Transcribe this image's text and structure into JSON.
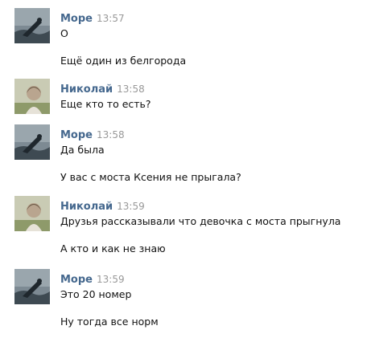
{
  "messages": [
    {
      "author": "Море",
      "time": "13:57",
      "avatar_icon": "sea-rock-avatar-icon",
      "lines": [
        "О",
        "Ещё один из белгорода"
      ]
    },
    {
      "author": "Николай",
      "time": "13:58",
      "avatar_icon": "girl-photo-avatar-icon",
      "lines": [
        "Еще кто то есть?"
      ]
    },
    {
      "author": "Море",
      "time": "13:58",
      "avatar_icon": "sea-rock-avatar-icon",
      "lines": [
        "Да была",
        "У вас с моста Ксения не прыгала?"
      ]
    },
    {
      "author": "Николай",
      "time": "13:59",
      "avatar_icon": "girl-photo-avatar-icon",
      "lines": [
        "Друзья рассказывали что девочка с моста прыгнула",
        "А кто и как не знаю"
      ]
    },
    {
      "author": "Море",
      "time": "13:59",
      "avatar_icon": "sea-rock-avatar-icon",
      "lines": [
        "Это 20 номер",
        "Ну тогда все норм"
      ]
    }
  ],
  "colors": {
    "author_name": "#45688e",
    "timestamp": "#999999",
    "message_text": "#111111",
    "background": "#ffffff"
  }
}
